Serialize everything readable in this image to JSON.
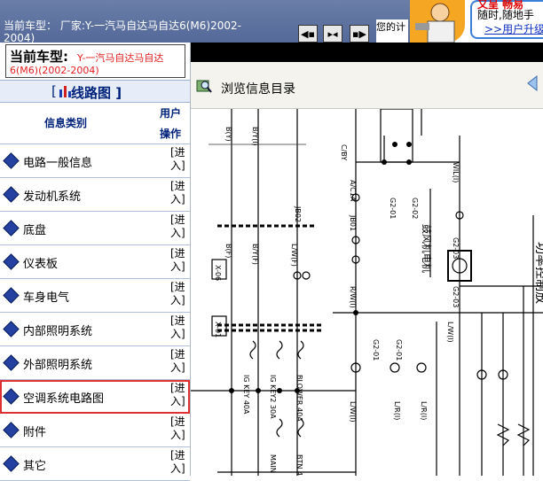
{
  "topbar": {
    "vehicle_line1": "当前车型：  厂家:Y-一汽马自达马自达6(M6)2002-",
    "vehicle_line2": "2004)",
    "nav_buttons": [
      "prev-page-icon",
      "split-view-icon",
      "next-page-icon"
    ],
    "hint_text": "您的计"
  },
  "promo": {
    "line1": "又呈  畅易",
    "line2": "随时,随地手",
    "link": ">>用户升级"
  },
  "left_panel": {
    "current_model_label": "当前车型:",
    "current_model_value1": "Y-一汽马自达马自达",
    "current_model_value2": "6(M6)(2002-2004)",
    "section_prefix": "[",
    "section_title": "线路图",
    "section_suffix": "]",
    "col_category": "信息类别",
    "col_user": "用户",
    "col_action": "操作",
    "enter_label": "[进入]",
    "items": [
      {
        "label": "电路一般信息"
      },
      {
        "label": "发动机系统"
      },
      {
        "label": "底盘"
      },
      {
        "label": "仪表板"
      },
      {
        "label": "车身电气"
      },
      {
        "label": "内部照明系统"
      },
      {
        "label": "外部照明系统"
      },
      {
        "label": "空调系统电路图"
      },
      {
        "label": "附件"
      },
      {
        "label": "其它"
      }
    ]
  },
  "right_panel": {
    "browse_label": "浏览信息目录",
    "diagram": {
      "labels": [
        "B(Y)",
        "B/Y(I)",
        "JB02",
        "C/BY",
        "G2-01",
        "G2-02",
        "JB01",
        "A/C1A",
        "WIL(I)",
        "G2-03",
        "鼓风机电机",
        "G2-03",
        "B(F)",
        "B/Y(F)",
        "L/W(F)",
        "R/W(I)",
        "L/W(I)",
        "G2-01",
        "G2-01",
        "IG KEY 40A",
        "IG KEY2 30A",
        "BLOWER 40A",
        "MAIN 100A",
        "BTN 40A",
        "L/R(I)",
        "L/R(I)",
        "L/W(I)",
        "X-06",
        "X-01",
        "功率控制放"
      ],
      "colors": {
        "line": "#000000",
        "fuse_dash": "#000000"
      }
    }
  }
}
